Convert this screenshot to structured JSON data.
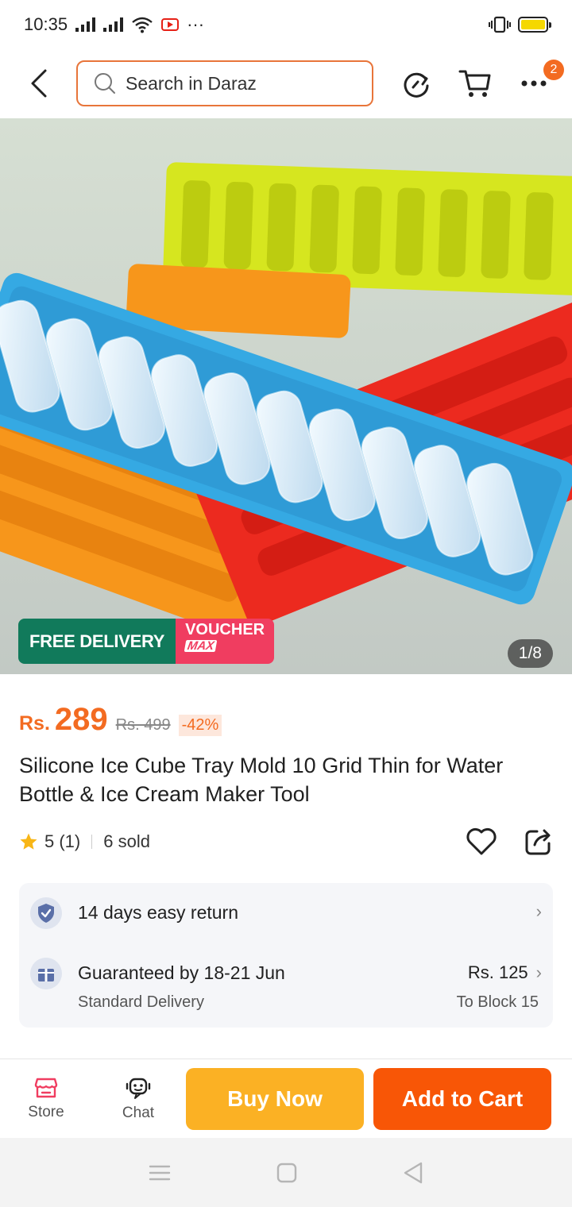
{
  "status_bar": {
    "time": "10:35",
    "more": "···"
  },
  "header": {
    "search_placeholder": "Search in Daraz",
    "cart_badge_count": "2"
  },
  "product_image": {
    "free_delivery_label": "FREE DELIVERY",
    "voucher_label": "VOUCHER",
    "voucher_sub_label": "MAX",
    "counter": "1/8"
  },
  "price": {
    "currency": "Rs.",
    "current": "289",
    "original": "Rs. 499",
    "discount": "-42%",
    "accent_color": "#f36b21"
  },
  "product": {
    "title": "Silicone Ice Cube Tray Mold 10 Grid Thin for Water Bottle & Ice Cream Maker Tool",
    "rating": "5 (1)",
    "sold": "6 sold"
  },
  "info": {
    "return_label": "14 days easy return",
    "delivery_label": "Guaranteed by 18-21 Jun",
    "delivery_type": "Standard Delivery",
    "delivery_fee": "Rs. 125",
    "delivery_location": "To Block 15"
  },
  "action_bar": {
    "store_label": "Store",
    "chat_label": "Chat",
    "buy_now_label": "Buy Now",
    "add_to_cart_label": "Add to Cart",
    "buy_color": "#fbb124",
    "cart_color": "#f85606"
  }
}
